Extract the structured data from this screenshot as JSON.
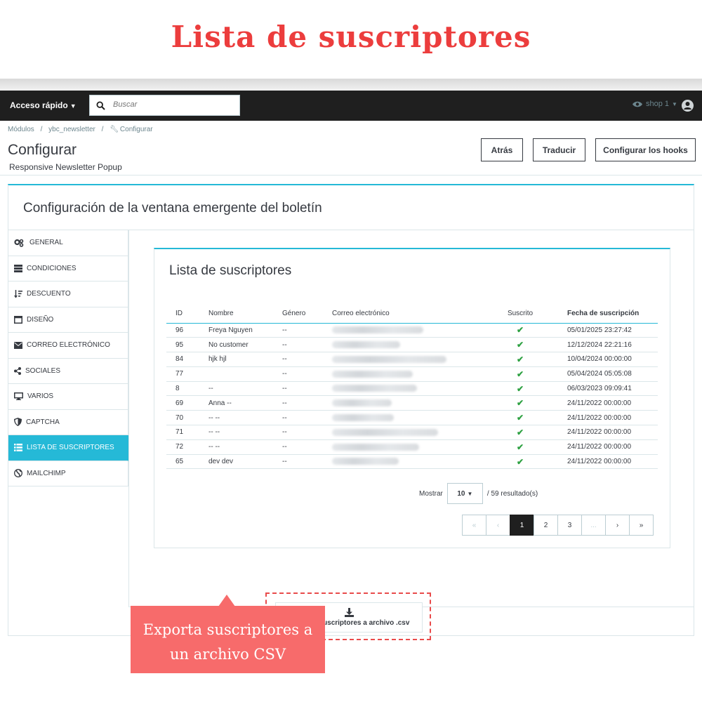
{
  "banner": {
    "title": "Lista de suscriptores"
  },
  "topbar": {
    "quick_access": "Acceso rápido",
    "search_placeholder": "Buscar",
    "shop": "shop 1"
  },
  "breadcrumb": [
    "Módulos",
    "/",
    "ybc_newsletter",
    "/",
    "Configurar"
  ],
  "header": {
    "title": "Configurar",
    "subtitle": "Responsive Newsletter Popup",
    "buttons": {
      "back": "Atrás",
      "translate": "Traducir",
      "hooks": "Configurar los hooks"
    }
  },
  "card": {
    "title": "Configuración de la ventana emergente del boletín"
  },
  "sidebar": {
    "items": [
      {
        "label": "GENERAL",
        "icon": "gears-icon"
      },
      {
        "label": "CONDICIONES",
        "icon": "server-icon"
      },
      {
        "label": "DESCUENTO",
        "icon": "sort-amount-icon"
      },
      {
        "label": "DISEÑO",
        "icon": "window-icon"
      },
      {
        "label": "CORREO ELECTRÓNICO",
        "icon": "envelope-icon"
      },
      {
        "label": "SOCIALES",
        "icon": "share-icon"
      },
      {
        "label": "VARIOS",
        "icon": "desktop-icon"
      },
      {
        "label": "CAPTCHA",
        "icon": "shield-icon"
      },
      {
        "label": "LISTA DE SUSCRIPTORES",
        "icon": "list-icon",
        "active": true
      },
      {
        "label": "MAILCHIMP",
        "icon": "globe-icon"
      }
    ]
  },
  "panel": {
    "title": "Lista de suscriptores",
    "columns": [
      "ID",
      "Nombre",
      "Género",
      "Correo electrónico",
      "Suscrito",
      "Fecha de suscripción"
    ],
    "rows": [
      {
        "id": "96",
        "name": "Freya Nguyen",
        "gender": "--",
        "date": "05/01/2025 23:27:42"
      },
      {
        "id": "95",
        "name": "No customer",
        "gender": "--",
        "date": "12/12/2024 22:21:16"
      },
      {
        "id": "84",
        "name": "hjk hjl",
        "gender": "--",
        "date": "10/04/2024 00:00:00"
      },
      {
        "id": "77",
        "name": "",
        "gender": "--",
        "date": "05/04/2024 05:05:08"
      },
      {
        "id": "8",
        "name": "--",
        "gender": "--",
        "date": "06/03/2023 09:09:41"
      },
      {
        "id": "69",
        "name": "Anna --",
        "gender": "--",
        "date": "24/11/2022 00:00:00"
      },
      {
        "id": "70",
        "name": "-- --",
        "gender": "--",
        "date": "24/11/2022 00:00:00"
      },
      {
        "id": "71",
        "name": "-- --",
        "gender": "--",
        "date": "24/11/2022 00:00:00"
      },
      {
        "id": "72",
        "name": "-- --",
        "gender": "--",
        "date": "24/11/2022 00:00:00"
      },
      {
        "id": "65",
        "name": "dev dev",
        "gender": "--",
        "date": "24/11/2022 00:00:00"
      }
    ],
    "show_label": "Mostrar",
    "per_page": "10",
    "results": "/ 59 resultado(s)",
    "pages": [
      "«",
      "‹",
      "1",
      "2",
      "3",
      "...",
      "›",
      "»"
    ],
    "current_page": "1"
  },
  "export": {
    "label": "Exportar suscriptores a archivo .csv"
  },
  "callout": {
    "line1": "Exporta suscriptores a",
    "line2": "un archivo CSV"
  },
  "colors": {
    "accent": "#25b9d7",
    "banner_red": "#ec3d3d",
    "callout": "#f76b6b",
    "check": "#2ea142"
  }
}
